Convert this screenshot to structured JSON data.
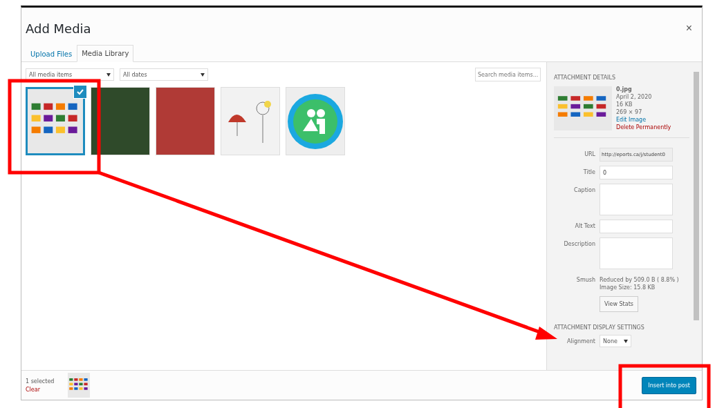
{
  "window": {
    "title": "Add Media",
    "close": "×"
  },
  "tabs": [
    {
      "label": "Upload Files",
      "selected": false
    },
    {
      "label": "Media Library",
      "selected": true
    }
  ],
  "filters": [
    {
      "value": "All media items"
    },
    {
      "value": "All dates"
    }
  ],
  "search": {
    "placeholder": "Search media items..."
  },
  "media": [
    {
      "kind": "flags",
      "selected": true
    },
    {
      "kind": "photo",
      "selected": false,
      "color": "#2f4a2a"
    },
    {
      "kind": "photo",
      "selected": false,
      "color": "#b03a36"
    },
    {
      "kind": "sketch",
      "selected": false
    },
    {
      "kind": "logo",
      "selected": false
    }
  ],
  "details": {
    "heading": "ATTACHMENT DETAILS",
    "filename": "0.jpg",
    "date": "April 2, 2020",
    "size": "16 KB",
    "dimensions": "269 × 97",
    "edit_link": "Edit Image",
    "delete_link": "Delete Permanently",
    "fields": [
      {
        "label": "URL",
        "kind": "readonly",
        "value": "http://eports.ca/j/student0"
      },
      {
        "label": "Title",
        "kind": "input",
        "value": "0"
      },
      {
        "label": "Caption",
        "kind": "textarea"
      },
      {
        "label": "Alt Text",
        "kind": "input"
      },
      {
        "label": "Description",
        "kind": "textarea"
      }
    ],
    "smush": {
      "label": "Smush",
      "lines": [
        "Reduced by 509.0 B ( 8.8% )",
        "Image Size: 15.8 KB"
      ]
    },
    "stats_button": "View Stats",
    "display_heading": "ATTACHMENT DISPLAY SETTINGS",
    "alignment": {
      "label": "Alignment",
      "value": "None"
    }
  },
  "footer": {
    "count": "1 selected",
    "clear": "Clear",
    "button": "Insert into post"
  }
}
